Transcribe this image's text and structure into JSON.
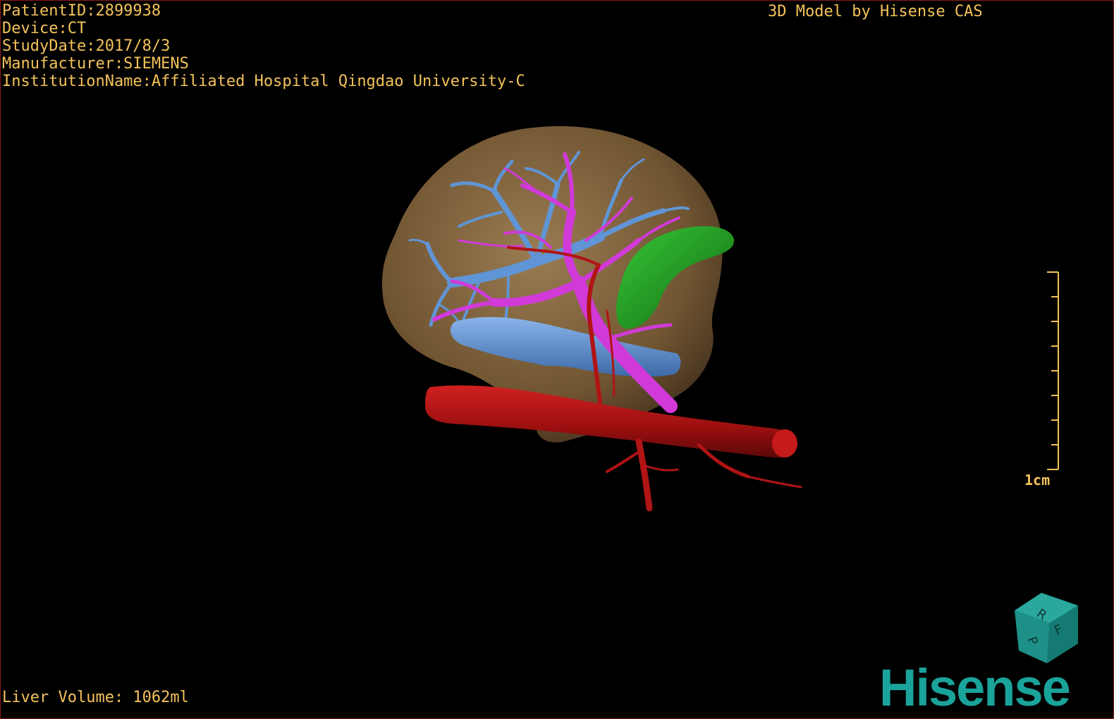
{
  "header": {
    "patient_id": "PatientID:2899938",
    "device": "Device:CT",
    "study_date": "StudyDate:2017/8/3",
    "manufacturer": "Manufacturer:SIEMENS",
    "institution": "InstitutionName:Affiliated Hospital Qingdao University-C"
  },
  "brand_caption": "3D Model by Hisense CAS",
  "liver_volume": "Liver Volume: 1062ml",
  "scale_bar": {
    "label": "1cm"
  },
  "orientation_cube": {
    "labels": [
      "R",
      "F",
      "P"
    ]
  },
  "logo": {
    "text": "Hisense"
  },
  "colors": {
    "overlay_text": "#f3c25a",
    "liver": "#8a6b42",
    "hepatic_vein": "#5b8fd0",
    "portal_vein": "#d23ad6",
    "artery_aorta": "#b01414",
    "gallbladder": "#1e9a1e",
    "logo": "#1aa39a"
  }
}
